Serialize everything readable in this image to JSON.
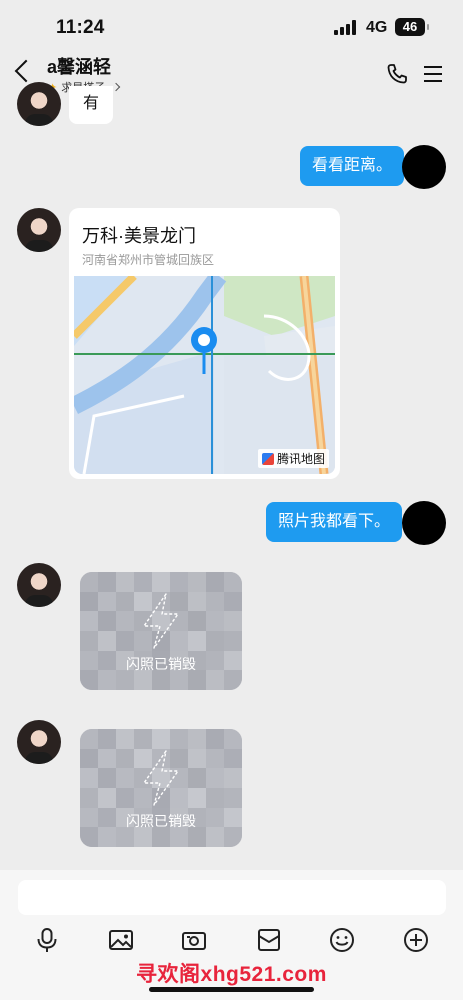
{
  "status": {
    "time": "11:24",
    "network": "4G",
    "battery": "46"
  },
  "header": {
    "name": "a馨涵轻",
    "subtitle": "求星搭子"
  },
  "messages": {
    "m1_text": "有",
    "m2_text": "看看距离。",
    "location": {
      "title": "万科·美景龙门",
      "address": "河南省郑州市管城回族区",
      "map_provider": "腾讯地图"
    },
    "m4_text": "照片我都看下。",
    "flash1_label": "闪照已销毁",
    "flash2_label": "闪照已销毁"
  },
  "toolbar": {
    "icons": [
      "mic-icon",
      "image-icon",
      "camera-icon",
      "red-packet-icon",
      "emoji-icon",
      "plus-icon"
    ]
  },
  "watermark": "寻欢阁xhg521.com",
  "colors": {
    "outgoing_bubble": "#1e9bf0",
    "background": "#ededed",
    "watermark": "#e8243c",
    "accent_pin": "#1a8cf0"
  }
}
